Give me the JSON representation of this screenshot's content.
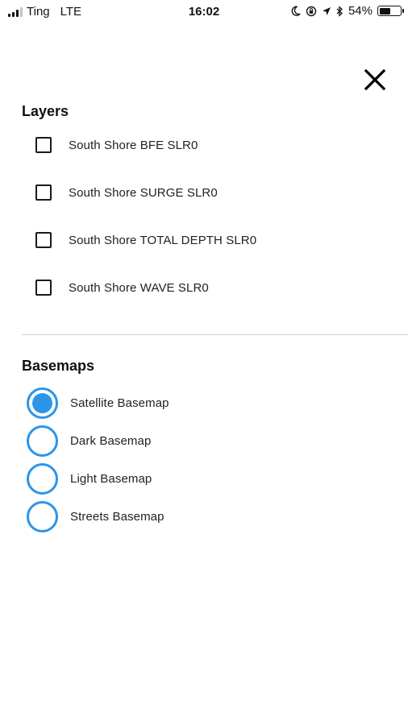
{
  "status_bar": {
    "carrier": "Ting",
    "network": "LTE",
    "time": "16:02",
    "battery_percent": "54%",
    "battery_level": 0.54,
    "icons": [
      "moon-icon",
      "orientation-lock-icon",
      "location-arrow-icon",
      "bluetooth-icon",
      "battery-icon"
    ]
  },
  "close_icon": "close-icon",
  "layers": {
    "title": "Layers",
    "items": [
      {
        "label": "South Shore BFE SLR0",
        "checked": false
      },
      {
        "label": "South Shore SURGE SLR0",
        "checked": false
      },
      {
        "label": "South Shore TOTAL DEPTH SLR0",
        "checked": false
      },
      {
        "label": "South Shore WAVE SLR0",
        "checked": false
      }
    ]
  },
  "basemaps": {
    "title": "Basemaps",
    "items": [
      {
        "label": "Satellite Basemap",
        "selected": true
      },
      {
        "label": "Dark Basemap",
        "selected": false
      },
      {
        "label": "Light Basemap",
        "selected": false
      },
      {
        "label": "Streets Basemap",
        "selected": false
      }
    ]
  },
  "colors": {
    "accent": "#2b95e9",
    "text": "#1a1a1a",
    "divider": "#cfcfcf"
  }
}
